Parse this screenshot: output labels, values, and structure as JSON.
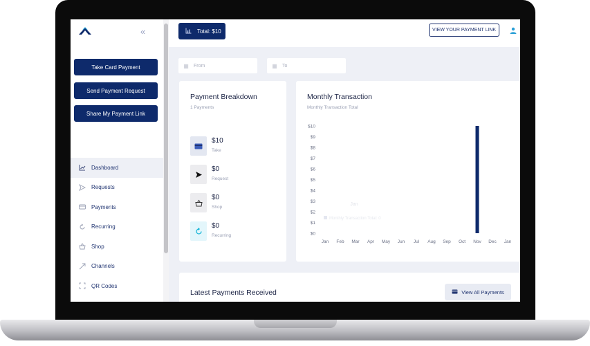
{
  "sidebar": {
    "actions": [
      "Take Card Payment",
      "Send Payment Request",
      "Share My Payment Link"
    ],
    "nav": [
      {
        "label": "Dashboard",
        "icon": "chart-icon"
      },
      {
        "label": "Requests",
        "icon": "send-icon"
      },
      {
        "label": "Payments",
        "icon": "card-icon"
      },
      {
        "label": "Recurring",
        "icon": "recurring-icon"
      },
      {
        "label": "Shop",
        "icon": "basket-icon"
      },
      {
        "label": "Channels",
        "icon": "channels-icon"
      },
      {
        "label": "QR Codes",
        "icon": "qr-icon"
      }
    ],
    "active": "Dashboard"
  },
  "topbar": {
    "total_label": "Total: $10",
    "view_link_label": "VIEW YOUR PAYMENT LINK"
  },
  "filters": {
    "from_placeholder": "From",
    "to_placeholder": "To"
  },
  "breakdown": {
    "title": "Payment Breakdown",
    "subtitle": "1 Payments",
    "items": [
      {
        "value": "$10",
        "label": "Take",
        "icon": "card-icon",
        "color": "#e3e7f1"
      },
      {
        "value": "$0",
        "label": "Request",
        "icon": "send-icon",
        "color": "#ececef"
      },
      {
        "value": "$0",
        "label": "Shop",
        "icon": "basket-icon",
        "color": "#ececef"
      },
      {
        "value": "$0",
        "label": "Recurring",
        "icon": "recurring-icon",
        "color": "#e3f6fb"
      }
    ]
  },
  "monthly": {
    "title": "Monthly Transaction",
    "subtitle": "Monthly Transaction Total"
  },
  "chart_data": {
    "type": "bar",
    "categories": [
      "Jan",
      "Feb",
      "Mar",
      "Apr",
      "May",
      "Jun",
      "Jul",
      "Aug",
      "Sep",
      "Oct",
      "Nov",
      "Dec",
      "Jan"
    ],
    "values": [
      0,
      0,
      0,
      0,
      0,
      0,
      0,
      0,
      0,
      0,
      10,
      0,
      0
    ],
    "y_ticks": [
      "$0",
      "$1",
      "$2",
      "$3",
      "$4",
      "$5",
      "$6",
      "$7",
      "$8",
      "$9",
      "$10"
    ],
    "ylim": [
      0,
      10
    ],
    "bar_color": "#0e2a6b",
    "tooltip": {
      "title": "Jan",
      "text": "Monthly Transaction Total: 0"
    },
    "grid": false
  },
  "latest": {
    "title": "Latest Payments Received",
    "view_all_label": "View All Payments"
  },
  "colors": {
    "primary": "#0e2a6b",
    "background": "#eef0f6"
  }
}
